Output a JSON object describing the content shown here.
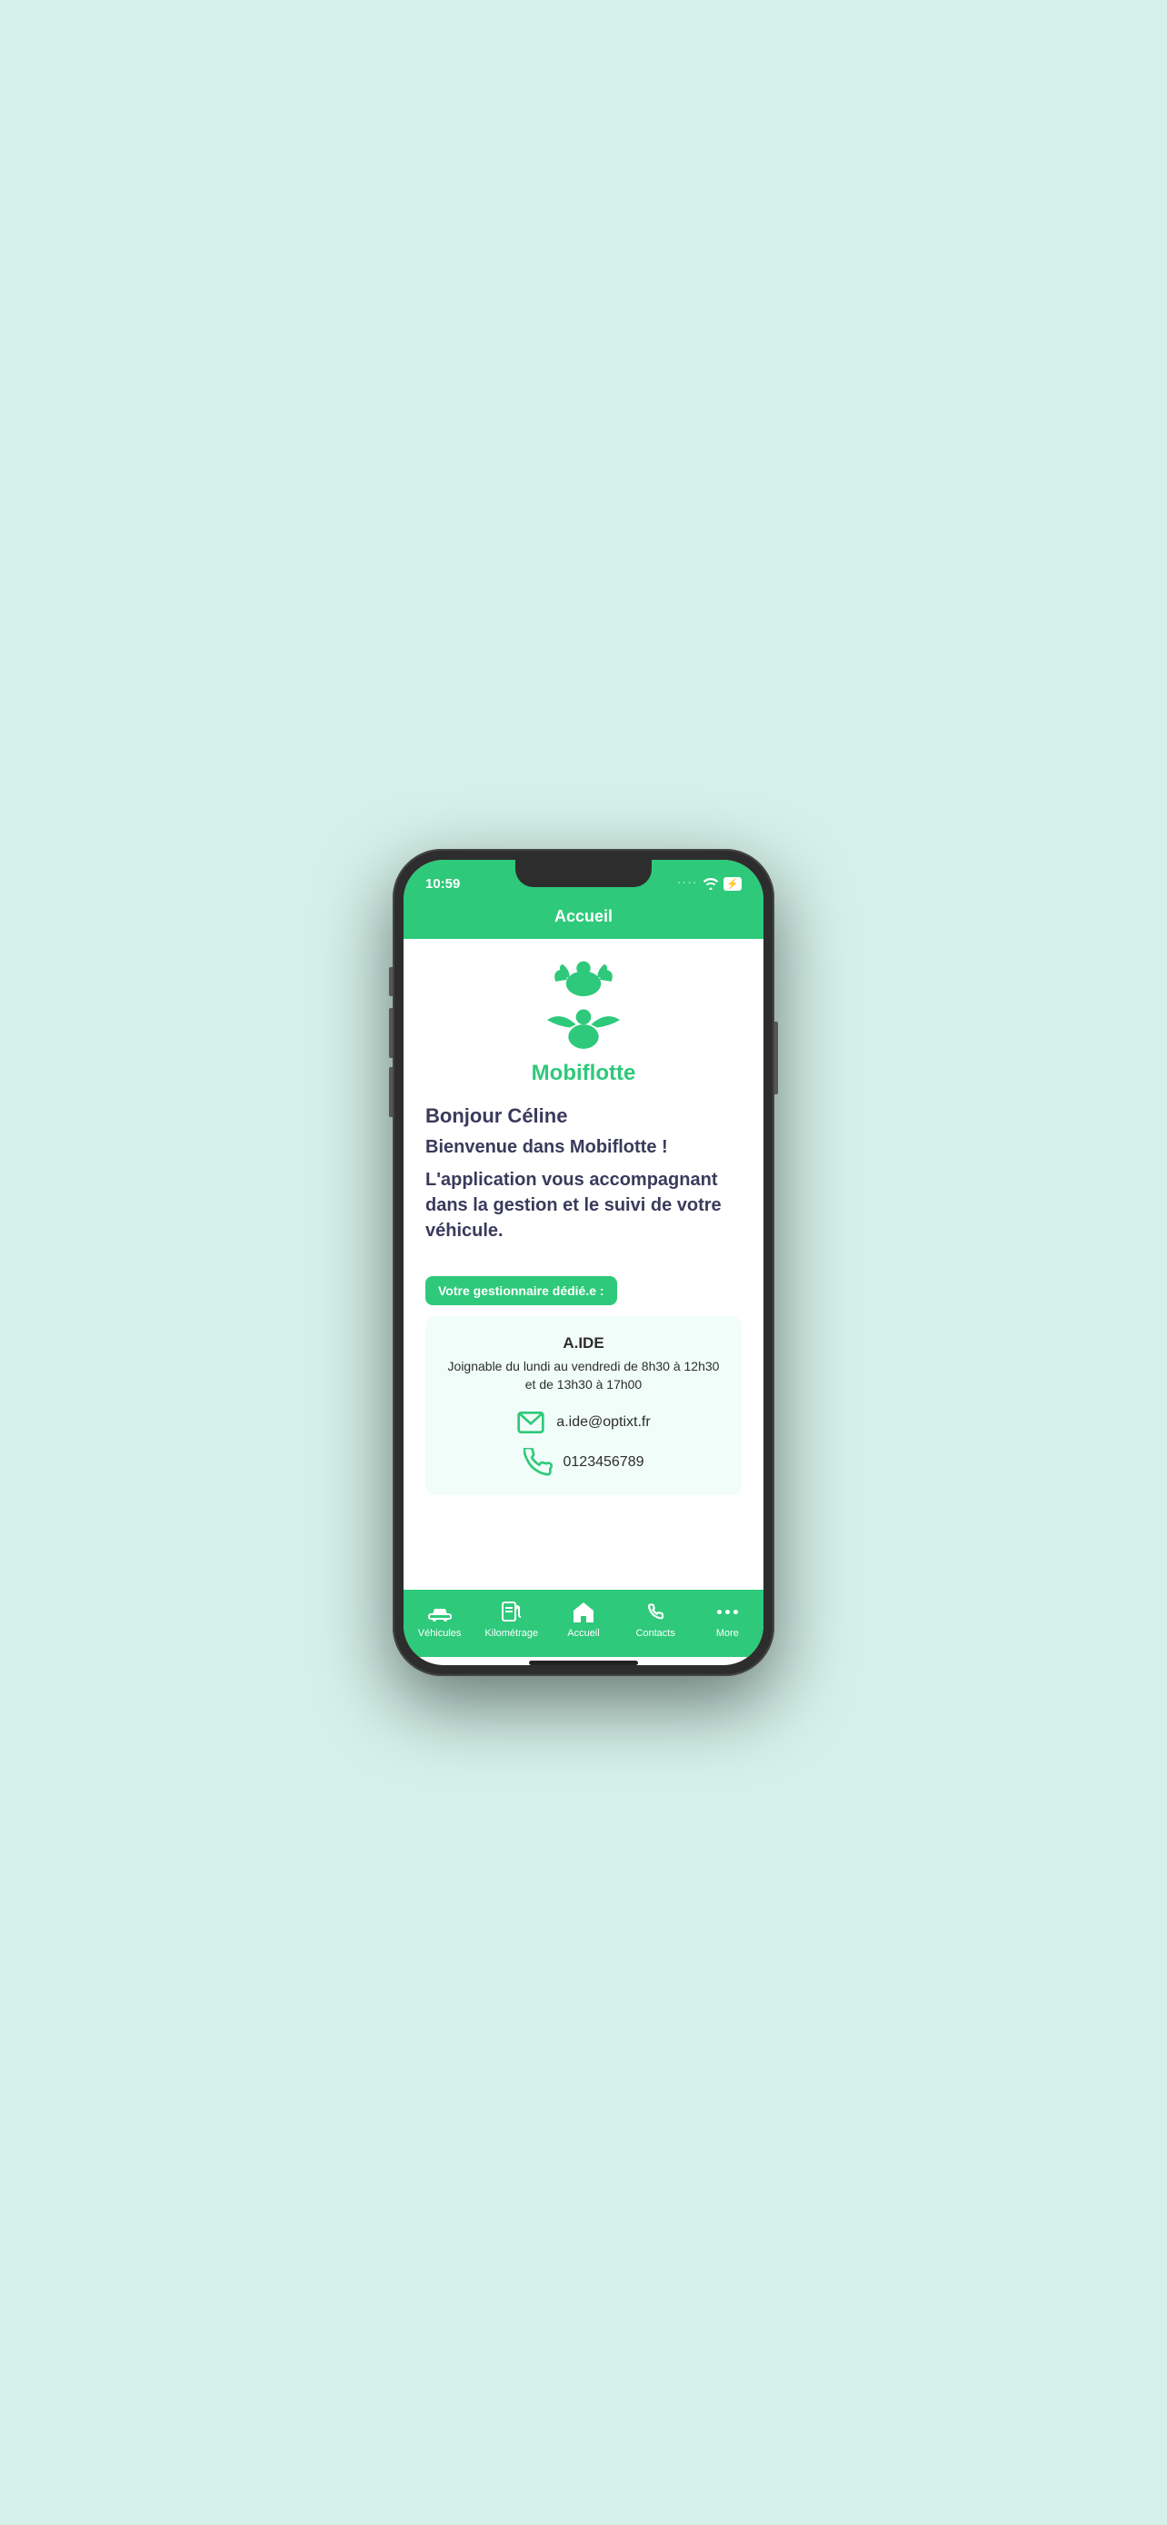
{
  "phone": {
    "status": {
      "time": "10:59",
      "wifi": "wifi",
      "battery": "⚡"
    },
    "header": {
      "title": "Accueil"
    },
    "logo": {
      "text": "Mobiflotte"
    },
    "welcome": {
      "greeting": "Bonjour Céline",
      "welcome_line": "Bienvenue dans Mobiflotte !",
      "description": "L'application vous accompagnant dans la gestion et le suivi de votre véhicule."
    },
    "manager": {
      "badge_label": "Votre gestionnaire dédié.e :",
      "name": "A.IDE",
      "hours": "Joignable du lundi au vendredi de 8h30 à 12h30 et de 13h30 à 17h00",
      "email": "a.ide@optixt.fr",
      "phone": "0123456789"
    },
    "nav": {
      "items": [
        {
          "id": "vehicules",
          "label": "Véhicules",
          "icon": "car"
        },
        {
          "id": "kilometrage",
          "label": "Kilométrage",
          "icon": "fuel"
        },
        {
          "id": "accueil",
          "label": "Accueil",
          "icon": "home",
          "active": true
        },
        {
          "id": "contacts",
          "label": "Contacts",
          "icon": "phone"
        },
        {
          "id": "more",
          "label": "More",
          "icon": "dots"
        }
      ]
    }
  }
}
